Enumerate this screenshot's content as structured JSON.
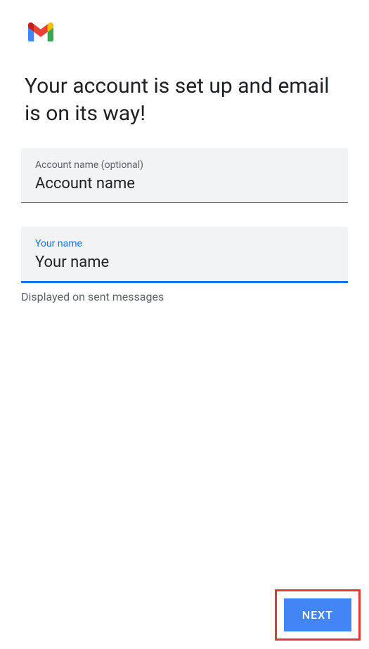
{
  "heading": "Your account is set up and email is on its way!",
  "fields": {
    "account_name": {
      "label": "Account name (optional)",
      "value": "Account name"
    },
    "your_name": {
      "label": "Your name",
      "value": "Your name",
      "helper": "Displayed on sent messages"
    }
  },
  "button": {
    "next_label": "NEXT"
  },
  "icons": {
    "gmail": "gmail-logo"
  }
}
